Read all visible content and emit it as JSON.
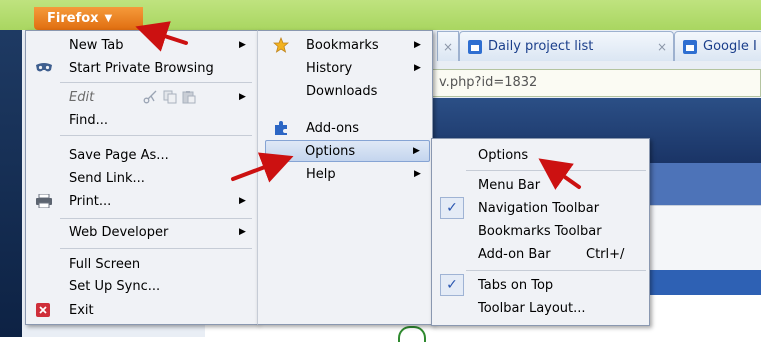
{
  "firefox_button": {
    "label": "Firefox",
    "caret": "▼"
  },
  "tabs": [
    {
      "label": "",
      "close": "×"
    },
    {
      "label": "Daily project list",
      "close": "×"
    },
    {
      "label": "Google I",
      "close": ""
    }
  ],
  "urlbar": {
    "value": "v.php?id=1832"
  },
  "main_menu": {
    "items": [
      {
        "label": "New Tab",
        "has_submenu": true
      },
      {
        "label": "Start Private Browsing",
        "icon": "private-browsing-mask-icon"
      },
      {
        "label": "Edit",
        "has_submenu": true,
        "icons": [
          "cut-icon",
          "copy-icon",
          "paste-icon"
        ]
      },
      {
        "label": "Find..."
      },
      {
        "label": "Save Page As..."
      },
      {
        "label": "Send Link..."
      },
      {
        "label": "Print...",
        "has_submenu": true,
        "icon": "printer-icon"
      },
      {
        "label": "Web Developer",
        "has_submenu": true
      },
      {
        "label": "Full Screen"
      },
      {
        "label": "Set Up Sync..."
      },
      {
        "label": "Exit",
        "icon": "exit-icon"
      }
    ]
  },
  "right_menu": {
    "items": [
      {
        "label": "Bookmarks",
        "has_submenu": true,
        "icon": "star-icon"
      },
      {
        "label": "History",
        "has_submenu": true
      },
      {
        "label": "Downloads"
      },
      {
        "label": "Add-ons",
        "icon": "puzzle-piece-icon"
      },
      {
        "label": "Options",
        "has_submenu": true,
        "highlighted": true
      },
      {
        "label": "Help",
        "has_submenu": true
      }
    ]
  },
  "options_submenu": {
    "items": [
      {
        "label": "Options"
      },
      {
        "label": "Menu Bar",
        "checked": false
      },
      {
        "label": "Navigation Toolbar",
        "checked": true
      },
      {
        "label": "Bookmarks Toolbar",
        "checked": false
      },
      {
        "label": "Add-on Bar",
        "shortcut": "Ctrl+/",
        "checked": false
      },
      {
        "label": "Tabs on Top",
        "checked": true
      },
      {
        "label": "Toolbar Layout..."
      }
    ],
    "check_glyph": "✓"
  },
  "colors": {
    "firefox_orange": "#e8821f",
    "annotation_arrow": "#cc1111",
    "menu_bg": "#f0f2f6",
    "highlight": "#c4d5ee"
  },
  "submenu_arrow": "▶"
}
